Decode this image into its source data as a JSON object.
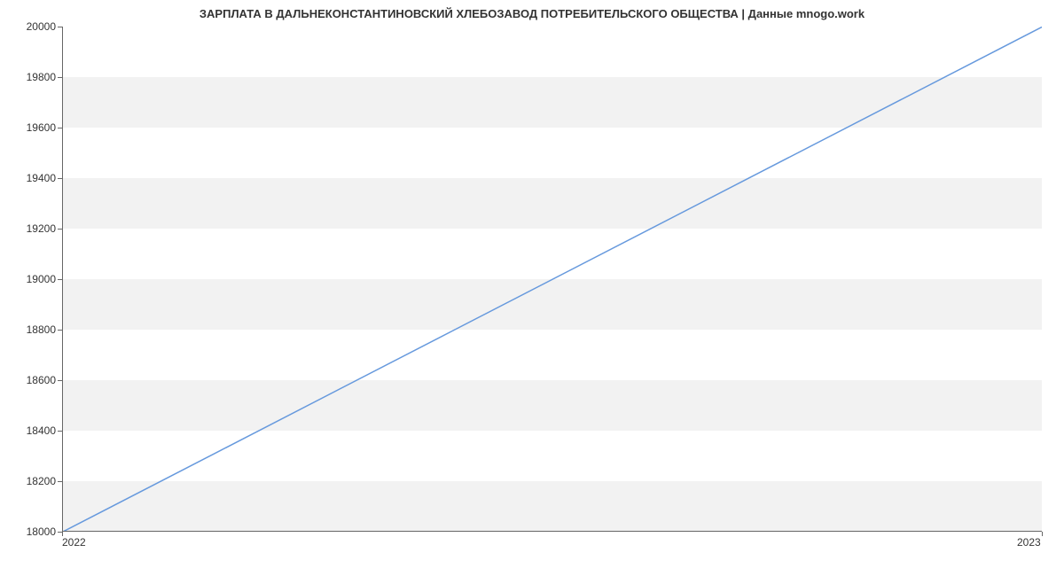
{
  "chart_data": {
    "type": "line",
    "title": "ЗАРПЛАТА В ДАЛЬНЕКОНСТАНТИНОВСКИЙ ХЛЕБОЗАВОД ПОТРЕБИТЕЛЬСКОГО ОБЩЕСТВА | Данные mnogo.work",
    "x": [
      2022,
      2023
    ],
    "values": [
      18000,
      20000
    ],
    "xlabel": "",
    "ylabel": "",
    "xlim": [
      2022,
      2023
    ],
    "ylim": [
      18000,
      20000
    ],
    "x_ticks": [
      2022,
      2023
    ],
    "y_ticks": [
      18000,
      18200,
      18400,
      18600,
      18800,
      19000,
      19200,
      19400,
      19600,
      19800,
      20000
    ],
    "line_color": "#6699dd",
    "grid": true
  }
}
